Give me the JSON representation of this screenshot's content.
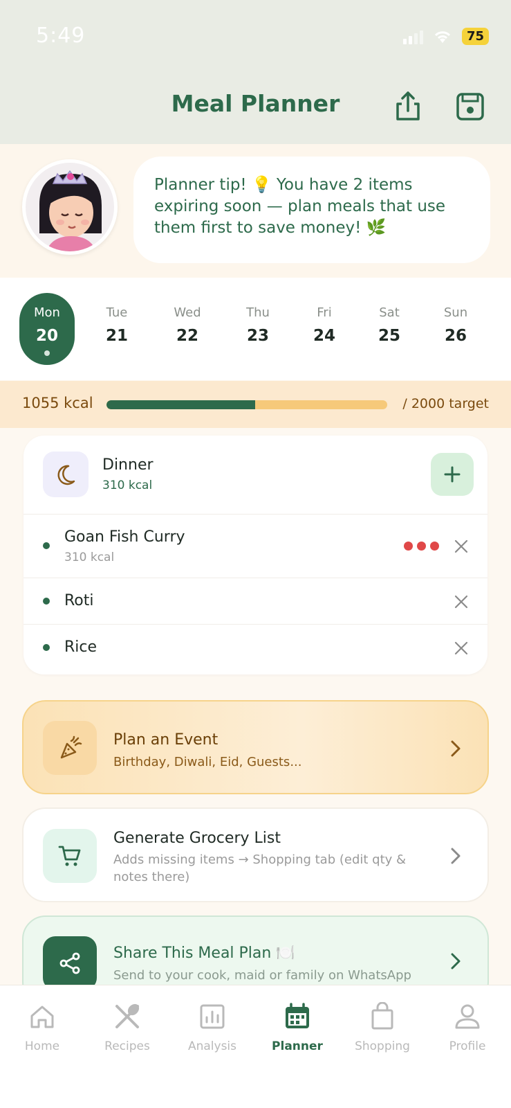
{
  "status": {
    "time": "5:49",
    "battery": "75"
  },
  "header": {
    "title": "Meal Planner",
    "share_icon": "share-icon",
    "save_icon": "save-icon"
  },
  "tip": {
    "text": "Planner tip! 💡 You have 2 items expiring soon — plan meals that use them first to save money! 🌿"
  },
  "days": [
    {
      "name": "Mon",
      "date": "20",
      "selected": true
    },
    {
      "name": "Tue",
      "date": "21"
    },
    {
      "name": "Wed",
      "date": "22"
    },
    {
      "name": "Thu",
      "date": "23"
    },
    {
      "name": "Fri",
      "date": "24"
    },
    {
      "name": "Sat",
      "date": "25"
    },
    {
      "name": "Sun",
      "date": "26"
    }
  ],
  "calories": {
    "consumed": "1055 kcal",
    "target": "/ 2000 target",
    "progress_fraction": 0.53
  },
  "meal": {
    "name": "Dinner",
    "kcal": "310 kcal",
    "items": [
      {
        "name": "Goan Fish Curry",
        "kcal": "310 kcal"
      },
      {
        "name": "Roti"
      },
      {
        "name": "Rice"
      }
    ]
  },
  "actions": {
    "event": {
      "title": "Plan an Event",
      "subtitle": "Birthday, Diwali, Eid, Guests..."
    },
    "grocery": {
      "title": "Generate Grocery List",
      "subtitle": "Adds missing items → Shopping tab (edit qty & notes there)"
    },
    "share": {
      "title": "Share This Meal Plan 🍽️",
      "subtitle": "Send to your cook, maid or family on WhatsApp"
    }
  },
  "nav": [
    {
      "label": "Home",
      "icon": "home-icon"
    },
    {
      "label": "Recipes",
      "icon": "utensils-icon"
    },
    {
      "label": "Analysis",
      "icon": "chart-icon"
    },
    {
      "label": "Planner",
      "icon": "calendar-icon",
      "active": true
    },
    {
      "label": "Shopping",
      "icon": "bag-icon"
    },
    {
      "label": "Profile",
      "icon": "person-icon"
    }
  ],
  "colors": {
    "primary": "#2d6a4b",
    "accent": "#f6c97a",
    "danger": "#e04848"
  }
}
